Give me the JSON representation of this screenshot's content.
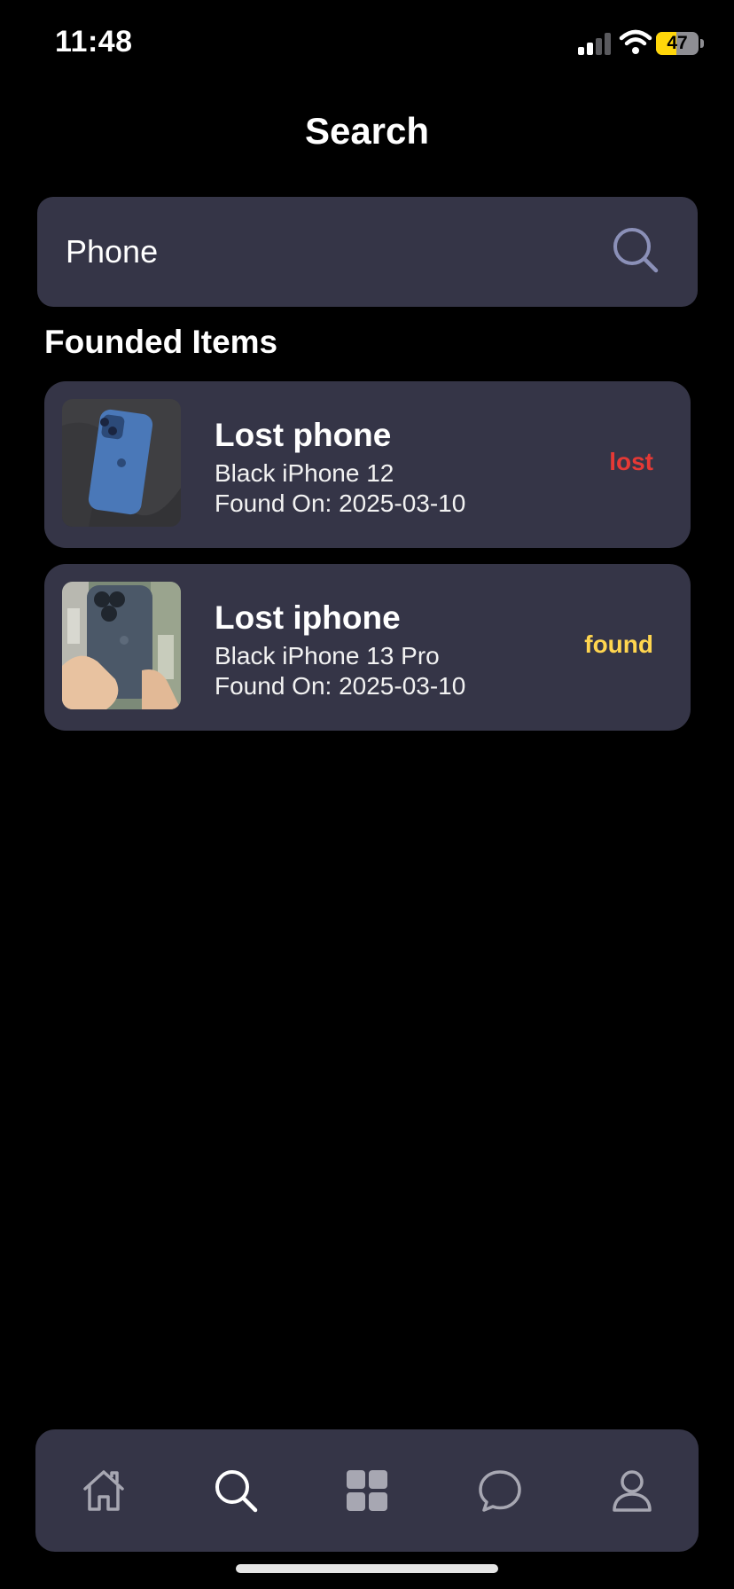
{
  "status_bar": {
    "time": "11:48",
    "battery_level": "47",
    "battery_fraction": 0.47,
    "signal_bars": 2,
    "signal_total": 4,
    "battery_color": "#ffd60a"
  },
  "header": {
    "title": "Search"
  },
  "search": {
    "value": "Phone",
    "placeholder": "",
    "icon": "search-icon"
  },
  "results": {
    "section_title": "Founded Items",
    "items": [
      {
        "title": "Lost phone",
        "description": "Black iPhone 12",
        "date_line": "Found On: 2025-03-10",
        "status": "lost",
        "status_color": "#e53935",
        "thumbnail": "blue-iphone-on-fabric"
      },
      {
        "title": "Lost iphone",
        "description": "Black iPhone 13 Pro",
        "date_line": "Found On: 2025-03-10",
        "status": "found",
        "status_color": "#ffd54f",
        "thumbnail": "hand-holding-iphone"
      }
    ]
  },
  "tab_bar": {
    "active_index": 1,
    "active_color": "#ffffff",
    "inactive_color": "#a7a7b2",
    "tabs": [
      {
        "icon": "home-icon"
      },
      {
        "icon": "search-icon"
      },
      {
        "icon": "grid-icon"
      },
      {
        "icon": "chat-bubble-icon"
      },
      {
        "icon": "profile-icon"
      }
    ]
  },
  "colors": {
    "background": "#000000",
    "surface": "#353547",
    "text": "#ffffff"
  }
}
